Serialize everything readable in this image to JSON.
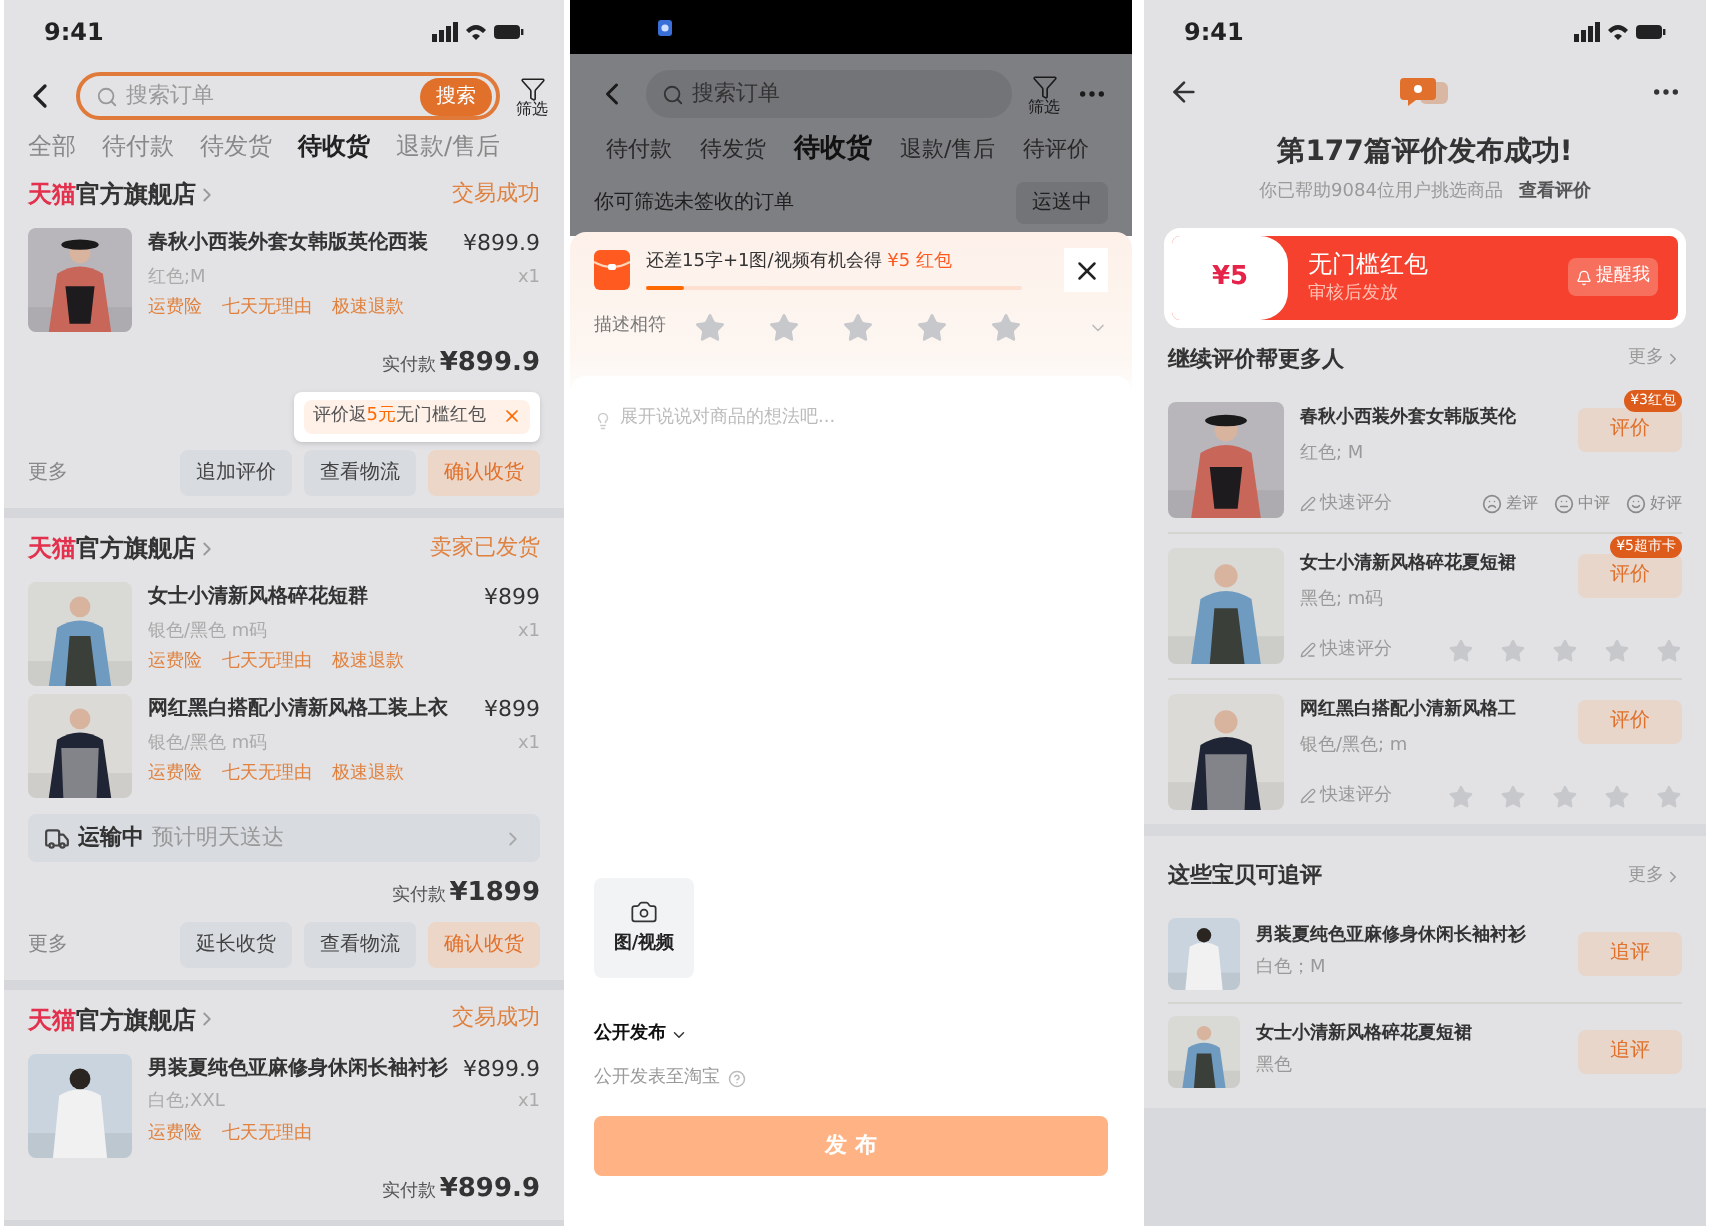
{
  "order_list": {
    "time": "9:41",
    "search": {
      "placeholder": "搜索订单",
      "button": "搜索",
      "filter": "筛选"
    },
    "tabs": [
      {
        "label": "全部",
        "selected": false
      },
      {
        "label": "待付款",
        "selected": false
      },
      {
        "label": "待发货",
        "selected": false
      },
      {
        "label": "待收货",
        "selected": true
      },
      {
        "label": "退款/售后",
        "selected": false
      }
    ],
    "orders": [
      {
        "brand": "天猫",
        "store": "官方旗舰店",
        "status": "交易成功",
        "items": [
          {
            "kind": "picture",
            "title": "春秋小西装外套女韩版英伦西装",
            "spec": "红色;M",
            "price": "¥899.9",
            "qty": "x1",
            "tags": [
              "运费险",
              "七天无理由",
              "极速退款"
            ]
          }
        ],
        "total_label": "实付款",
        "total": "¥899.9",
        "tooltip": {
          "before": "评价返",
          "highlight": "5元",
          "after": "无门槛红包"
        },
        "more": "更多",
        "actions": [
          {
            "label": "追加评价",
            "primary": false
          },
          {
            "label": "查看物流",
            "primary": false
          },
          {
            "label": "确认收货",
            "primary": true
          }
        ]
      },
      {
        "brand": "天猫",
        "store": "官方旗舰店",
        "status": "卖家已发货",
        "items": [
          {
            "kind": "picture",
            "title": "女士小清新风格碎花短群",
            "spec": "银色/黑色 m码",
            "price": "¥899",
            "qty": "x1",
            "tags": [
              "运费险",
              "七天无理由",
              "极速退款"
            ]
          },
          {
            "kind": "picture",
            "title": "网红黑白搭配小清新风格工装上衣",
            "spec": "银色/黑色 m码",
            "price": "¥899",
            "qty": "x1",
            "tags": [
              "运费险",
              "七天无理由",
              "极速退款"
            ]
          }
        ],
        "shipping": {
          "status": "运输中",
          "eta": "预计明天送达"
        },
        "total_label": "实付款",
        "total": "¥1899",
        "more": "更多",
        "actions": [
          {
            "label": "延长收货",
            "primary": false
          },
          {
            "label": "查看物流",
            "primary": false
          },
          {
            "label": "确认收货",
            "primary": true
          }
        ]
      },
      {
        "brand": "天猫",
        "store": "官方旗舰店",
        "status": "交易成功",
        "items": [
          {
            "kind": "picture",
            "title": "男装夏纯色亚麻修身休闲长袖衬衫",
            "spec": "白色;XXL",
            "price": "¥899.9",
            "qty": "x1",
            "tags": [
              "运费险",
              "七天无理由"
            ]
          }
        ],
        "total_label": "实付款",
        "total": "¥899.9"
      }
    ]
  },
  "review_form": {
    "search": {
      "placeholder": "搜索订单",
      "filter": "筛选"
    },
    "tabs": [
      {
        "label": "待付款",
        "selected": false
      },
      {
        "label": "待发货",
        "selected": false
      },
      {
        "label": "待收货",
        "selected": true
      },
      {
        "label": "退款/售后",
        "selected": false
      },
      {
        "label": "待评价",
        "selected": false
      }
    ],
    "hint": "你可筛选未签收的订单",
    "chip": "运送中",
    "reward": {
      "text": "还差15字+1图/视频有机会得",
      "highlight": "¥5 红包",
      "level": 0.1
    },
    "rating": {
      "label": "描述相符",
      "stars": 0
    },
    "placeholder": "展开说说对商品的想法吧...",
    "media_button": "图/视频",
    "visibility": "公开发布",
    "visibility_note": "公开发表至淘宝",
    "submit": "发 布"
  },
  "review_success": {
    "time": "9:41",
    "title": "第177篇评价发布成功!",
    "subtitle": "你已帮助9084位用户挑选商品",
    "link": "查看评价",
    "coupon": {
      "amount": "¥5",
      "name": "无门槛红包",
      "note": "审核后发放",
      "button": "提醒我"
    },
    "continue": {
      "title": "继续评价帮更多人",
      "more": "更多",
      "items": [
        {
          "kind": "faces",
          "title": "春秋小西装外套女韩版英伦",
          "spec": "红色; M",
          "badge": "¥3红包",
          "button": "评价",
          "quick": "快速评分",
          "faces": [
            "差评",
            "中评",
            "好评"
          ]
        },
        {
          "kind": "stars",
          "title": "女士小清新风格碎花夏短裙",
          "spec": "黑色; m码",
          "badge": "¥5超市卡",
          "button": "评价",
          "quick": "快速评分",
          "stars": 0
        },
        {
          "kind": "stars",
          "title": "网红黑白搭配小清新风格工",
          "spec": "银色/黑色; m",
          "button": "评价",
          "quick": "快速评分",
          "stars": 0
        }
      ]
    },
    "follow_up": {
      "title": "这些宝贝可追评",
      "more": "更多",
      "items": [
        {
          "title": "男装夏纯色亚麻修身休闲长袖衬衫",
          "spec": "白色；M",
          "button": "追评"
        },
        {
          "title": "女士小清新风格碎花夏短裙",
          "spec": "黑色",
          "button": "追评"
        }
      ]
    }
  }
}
